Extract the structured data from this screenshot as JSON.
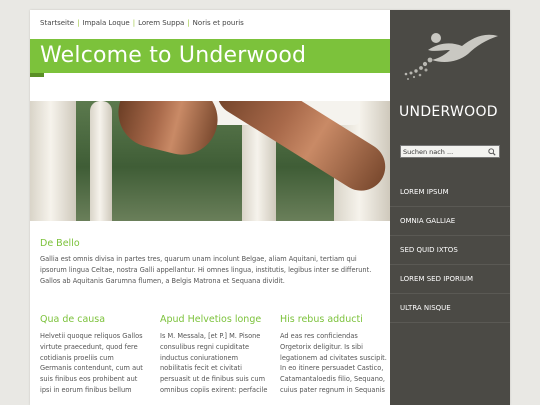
{
  "breadcrumb": {
    "items": [
      "Startseite",
      "Impala Loque",
      "Lorem Suppa",
      "Noris et pouris"
    ],
    "separator": "|"
  },
  "banner": {
    "title": "Welcome to Underwood"
  },
  "intro": {
    "heading": "De Bello",
    "text": "Gallia est omnis divisa in partes tres, quarum unam incolunt Belgae, aliam Aquitani, tertiam qui ipsorum lingua Celtae, nostra Galli appellantur. Hi omnes lingua, institutis, legibus inter se differunt. Gallos ab Aquitanis Garumna flumen, a Belgis Matrona et Sequana dividit."
  },
  "columns": [
    {
      "heading": "Qua de causa",
      "lines": [
        "Helvetii quoque reliquos Gallos",
        "virtute praecedunt, quod fere",
        "cotidianis proeliis cum",
        "Germanis contendunt, cum aut",
        "suis finibus eos prohibent aut",
        "ipsi in eorum finibus bellum"
      ]
    },
    {
      "heading": "Apud Helvetios longe",
      "lines": [
        "Is M. Messala, [et P.] M. Pisone",
        "consulibus regni cupiditate",
        "inductus coniurationem",
        "nobilitatis fecit et civitati",
        "persuasit ut de finibus suis cum",
        "omnibus copiis exirent: perfacile"
      ]
    },
    {
      "heading": "His rebus adducti",
      "lines": [
        "Ad eas res conficiendas",
        "Orgetorix deligitur. Is sibi",
        "legationem ad civitates suscipit.",
        "In eo itinere persuadet Castico,",
        "Catamantaloedis filio, Sequano,",
        "cuius pater regnum in Sequanis"
      ]
    }
  ],
  "sidebar": {
    "brand": "UNDERWOOD",
    "search": {
      "placeholder": "Suchen nach ..."
    },
    "nav": [
      "LOREM IPSUM",
      "OMNIA GALLIAE",
      "SED QUID IXTOS",
      "LOREM SED IPORIUM",
      "ULTRA NISQUE"
    ]
  },
  "colors": {
    "accent": "#7cc23b",
    "sidebar": "#4b4a45",
    "background": "#e9e8e4"
  }
}
